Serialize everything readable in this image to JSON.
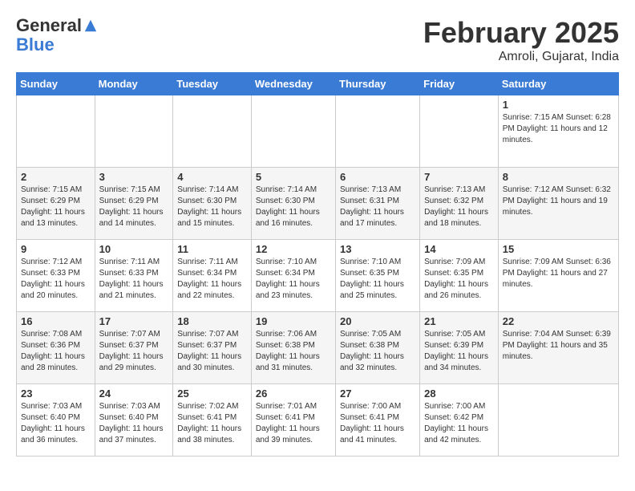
{
  "header": {
    "logo_general": "General",
    "logo_blue": "Blue",
    "month_title": "February 2025",
    "location": "Amroli, Gujarat, India"
  },
  "days_of_week": [
    "Sunday",
    "Monday",
    "Tuesday",
    "Wednesday",
    "Thursday",
    "Friday",
    "Saturday"
  ],
  "weeks": [
    {
      "cells": [
        {
          "day": null,
          "info": null
        },
        {
          "day": null,
          "info": null
        },
        {
          "day": null,
          "info": null
        },
        {
          "day": null,
          "info": null
        },
        {
          "day": null,
          "info": null
        },
        {
          "day": null,
          "info": null
        },
        {
          "day": "1",
          "info": "Sunrise: 7:15 AM\nSunset: 6:28 PM\nDaylight: 11 hours\nand 12 minutes."
        }
      ]
    },
    {
      "cells": [
        {
          "day": "2",
          "info": "Sunrise: 7:15 AM\nSunset: 6:29 PM\nDaylight: 11 hours\nand 13 minutes."
        },
        {
          "day": "3",
          "info": "Sunrise: 7:15 AM\nSunset: 6:29 PM\nDaylight: 11 hours\nand 14 minutes."
        },
        {
          "day": "4",
          "info": "Sunrise: 7:14 AM\nSunset: 6:30 PM\nDaylight: 11 hours\nand 15 minutes."
        },
        {
          "day": "5",
          "info": "Sunrise: 7:14 AM\nSunset: 6:30 PM\nDaylight: 11 hours\nand 16 minutes."
        },
        {
          "day": "6",
          "info": "Sunrise: 7:13 AM\nSunset: 6:31 PM\nDaylight: 11 hours\nand 17 minutes."
        },
        {
          "day": "7",
          "info": "Sunrise: 7:13 AM\nSunset: 6:32 PM\nDaylight: 11 hours\nand 18 minutes."
        },
        {
          "day": "8",
          "info": "Sunrise: 7:12 AM\nSunset: 6:32 PM\nDaylight: 11 hours\nand 19 minutes."
        }
      ]
    },
    {
      "cells": [
        {
          "day": "9",
          "info": "Sunrise: 7:12 AM\nSunset: 6:33 PM\nDaylight: 11 hours\nand 20 minutes."
        },
        {
          "day": "10",
          "info": "Sunrise: 7:11 AM\nSunset: 6:33 PM\nDaylight: 11 hours\nand 21 minutes."
        },
        {
          "day": "11",
          "info": "Sunrise: 7:11 AM\nSunset: 6:34 PM\nDaylight: 11 hours\nand 22 minutes."
        },
        {
          "day": "12",
          "info": "Sunrise: 7:10 AM\nSunset: 6:34 PM\nDaylight: 11 hours\nand 23 minutes."
        },
        {
          "day": "13",
          "info": "Sunrise: 7:10 AM\nSunset: 6:35 PM\nDaylight: 11 hours\nand 25 minutes."
        },
        {
          "day": "14",
          "info": "Sunrise: 7:09 AM\nSunset: 6:35 PM\nDaylight: 11 hours\nand 26 minutes."
        },
        {
          "day": "15",
          "info": "Sunrise: 7:09 AM\nSunset: 6:36 PM\nDaylight: 11 hours\nand 27 minutes."
        }
      ]
    },
    {
      "cells": [
        {
          "day": "16",
          "info": "Sunrise: 7:08 AM\nSunset: 6:36 PM\nDaylight: 11 hours\nand 28 minutes."
        },
        {
          "day": "17",
          "info": "Sunrise: 7:07 AM\nSunset: 6:37 PM\nDaylight: 11 hours\nand 29 minutes."
        },
        {
          "day": "18",
          "info": "Sunrise: 7:07 AM\nSunset: 6:37 PM\nDaylight: 11 hours\nand 30 minutes."
        },
        {
          "day": "19",
          "info": "Sunrise: 7:06 AM\nSunset: 6:38 PM\nDaylight: 11 hours\nand 31 minutes."
        },
        {
          "day": "20",
          "info": "Sunrise: 7:05 AM\nSunset: 6:38 PM\nDaylight: 11 hours\nand 32 minutes."
        },
        {
          "day": "21",
          "info": "Sunrise: 7:05 AM\nSunset: 6:39 PM\nDaylight: 11 hours\nand 34 minutes."
        },
        {
          "day": "22",
          "info": "Sunrise: 7:04 AM\nSunset: 6:39 PM\nDaylight: 11 hours\nand 35 minutes."
        }
      ]
    },
    {
      "cells": [
        {
          "day": "23",
          "info": "Sunrise: 7:03 AM\nSunset: 6:40 PM\nDaylight: 11 hours\nand 36 minutes."
        },
        {
          "day": "24",
          "info": "Sunrise: 7:03 AM\nSunset: 6:40 PM\nDaylight: 11 hours\nand 37 minutes."
        },
        {
          "day": "25",
          "info": "Sunrise: 7:02 AM\nSunset: 6:41 PM\nDaylight: 11 hours\nand 38 minutes."
        },
        {
          "day": "26",
          "info": "Sunrise: 7:01 AM\nSunset: 6:41 PM\nDaylight: 11 hours\nand 39 minutes."
        },
        {
          "day": "27",
          "info": "Sunrise: 7:00 AM\nSunset: 6:41 PM\nDaylight: 11 hours\nand 41 minutes."
        },
        {
          "day": "28",
          "info": "Sunrise: 7:00 AM\nSunset: 6:42 PM\nDaylight: 11 hours\nand 42 minutes."
        },
        {
          "day": null,
          "info": null
        }
      ]
    }
  ]
}
